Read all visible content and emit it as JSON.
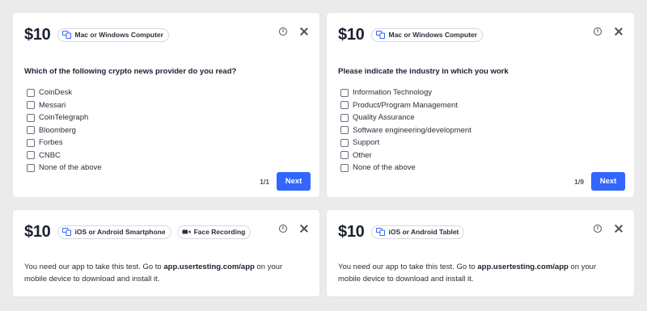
{
  "cards": [
    {
      "price": "$10",
      "chips": [
        {
          "label": "Mac or Windows Computer",
          "icon": "devices-icon"
        }
      ],
      "question": "Which of the following crypto news provider do you read?",
      "options": [
        "CoinDesk",
        "Messari",
        "CoinTelegraph",
        "Bloomberg",
        "Forbes",
        "CNBC",
        "None of the above"
      ],
      "counter": "1/1",
      "next_label": "Next"
    },
    {
      "price": "$10",
      "chips": [
        {
          "label": "Mac or Windows Computer",
          "icon": "devices-icon"
        }
      ],
      "question": "Please indicate the industry in which you work",
      "options": [
        "Information Technology",
        "Product/Program Management",
        "Quality Assurance",
        "Software engineering/development",
        "Support",
        "Other",
        "None of the above"
      ],
      "counter": "1/9",
      "next_label": "Next"
    },
    {
      "price": "$10",
      "chips": [
        {
          "label": "iOS or Android Smartphone",
          "icon": "devices-icon"
        },
        {
          "label": "Face Recording",
          "icon": "video-camera-icon"
        }
      ],
      "message_pre": "You need our app to take this test. Go to ",
      "message_link": "app.usertesting.com/app",
      "message_post": " on your mobile device to download and install it."
    },
    {
      "price": "$10",
      "chips": [
        {
          "label": "iOS or Android Tablet",
          "icon": "devices-icon"
        }
      ],
      "message_pre": "You need our app to take this test. Go to ",
      "message_link": "app.usertesting.com/app",
      "message_post": " on your mobile device to download and install it."
    }
  ],
  "colors": {
    "background": "#ebebed",
    "accent": "#3366ff",
    "chip_icon": "#3366ff"
  }
}
